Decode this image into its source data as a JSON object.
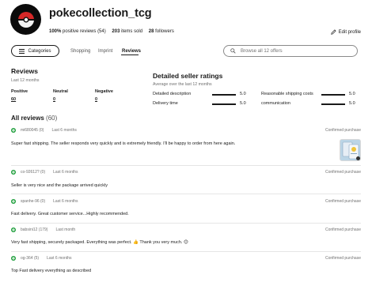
{
  "profile": {
    "store_name": "pokecollection_tcg",
    "positive_pct": "100%",
    "positive_label": "positive reviews",
    "review_count_paren": "(54)",
    "items_sold_num": "203",
    "items_sold_label": "items sold",
    "followers_num": "28",
    "followers_label": "followers",
    "edit_label": "Edit profile"
  },
  "nav": {
    "categories_label": "Categories",
    "links": [
      "Shopping",
      "Imprint",
      "Reviews"
    ],
    "active_index": 2,
    "search_placeholder": "Browse all 12 offers"
  },
  "reviews_summary": {
    "title": "Reviews",
    "period": "Last 12 months",
    "positive_label": "Positive",
    "positive_value": "60",
    "neutral_label": "Neutral",
    "neutral_value": "0",
    "negative_label": "Negative",
    "negative_value": "0"
  },
  "detailed_ratings": {
    "title": "Detailed seller ratings",
    "subtitle": "Average over the last 12 months",
    "items": [
      {
        "label": "Detailed description",
        "value": "5.0"
      },
      {
        "label": "Delivery time",
        "value": "5.0"
      },
      {
        "label": "Reasonable shipping costs",
        "value": "5.0"
      },
      {
        "label": "communication",
        "value": "5.0"
      }
    ],
    "scale_max": 5.0
  },
  "all_reviews": {
    "label": "All reviews",
    "count": "(60)"
  },
  "reviews": [
    {
      "user": "mi680045 (0)",
      "when": "Last 6 months",
      "status": "Confirmed purchase",
      "text": "Super fast shipping. The seller responds very quickly and is extremely friendly. I'll be happy to order from here again."
    },
    {
      "user": "co-92612? (0)",
      "when": "Last 6 months",
      "status": "Confirmed purchase",
      "text": "Seller is very nice and the package arrived quickly"
    },
    {
      "user": "spanhe-96 (0)",
      "when": "Last 6 months",
      "status": "Confirmed purchase",
      "text": "Fast delivery. Great customer service...Highly recommended."
    },
    {
      "user": "babsini12 (179)",
      "when": "Last month",
      "status": "Confirmed purchase",
      "text": "Very fast shipping, securely packaged. Everything was perfect. 👍 Thank you very much. 😊"
    },
    {
      "user": "og-364 (5)",
      "when": "Last 6 months",
      "status": "Confirmed purchase",
      "text": "Top Fast delivery everything as described"
    }
  ],
  "icons": {
    "avatar": "pokeball-logo",
    "edit": "pencil-icon",
    "categories": "menu-icon",
    "search": "search-icon",
    "review_dot": "plus-icon"
  },
  "colors": {
    "positive": "#1c9e3a",
    "text": "#191919",
    "muted": "#707070"
  }
}
